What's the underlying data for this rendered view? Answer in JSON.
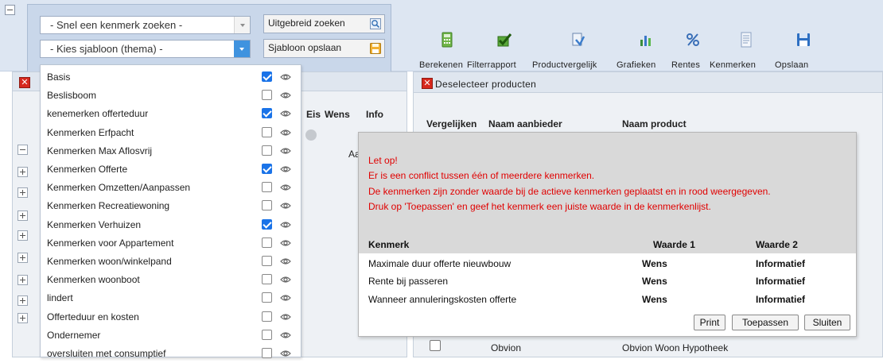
{
  "header": {
    "quick_search": {
      "value": "- Snel een kenmerk zoeken -"
    },
    "template_select": {
      "value": "- Kies sjabloon (thema) -"
    },
    "advanced_search_label": "Uitgebreid zoeken",
    "save_template_label": "Sjabloon opslaan",
    "toolbar": [
      {
        "label": "Berekenen",
        "icon": "calculator-icon"
      },
      {
        "label": "Filterrapport",
        "icon": "checkmark-icon"
      },
      {
        "label": "Productvergelijk",
        "icon": "compare-icon"
      },
      {
        "label": "Grafieken",
        "icon": "bar-chart-icon"
      },
      {
        "label": "Rentes",
        "icon": "percent-icon"
      },
      {
        "label": "Kenmerken",
        "icon": "document-icon"
      },
      {
        "label": "Opslaan",
        "icon": "floppy-icon"
      }
    ]
  },
  "left_panel": {
    "columns": [
      "Eis",
      "Wens",
      "Info"
    ],
    "row_label": "Aa"
  },
  "template_dropdown": {
    "items": [
      {
        "label": "Basis",
        "checked": true
      },
      {
        "label": "Beslisboom",
        "checked": false
      },
      {
        "label": "kenemerken offerteduur",
        "checked": true
      },
      {
        "label": "Kenmerken Erfpacht",
        "checked": false
      },
      {
        "label": "Kenmerken Max Aflosvrij",
        "checked": false
      },
      {
        "label": "Kenmerken Offerte",
        "checked": true
      },
      {
        "label": "Kenmerken Omzetten/Aanpassen",
        "checked": false
      },
      {
        "label": "Kenmerken Recreatiewoning",
        "checked": false
      },
      {
        "label": "Kenmerken Verhuizen",
        "checked": true
      },
      {
        "label": "Kenmerken voor Appartement",
        "checked": false
      },
      {
        "label": "Kenmerken woon/winkelpand",
        "checked": false
      },
      {
        "label": "Kenmerken woonboot",
        "checked": false
      },
      {
        "label": "lindert",
        "checked": false
      },
      {
        "label": "Offerteduur en kosten",
        "checked": false
      },
      {
        "label": "Ondernemer",
        "checked": false
      },
      {
        "label": "oversluiten met consumptief",
        "checked": false
      }
    ]
  },
  "right_panel": {
    "deselect_label": "Deselecteer producten",
    "columns": [
      "Vergelijken",
      "Naam aanbieder",
      "Naam product"
    ],
    "visible_row": {
      "aanbieder": "Obvion",
      "product": "Obvion Woon Hypotheek"
    }
  },
  "conflict_dialog": {
    "lines": [
      "Let op!",
      "Er is een conflict tussen één of meerdere kenmerken.",
      "De kenmerken zijn zonder waarde bij de actieve kenmerken geplaatst en in rood weergegeven.",
      "Druk op 'Toepassen' en geef het kenmerk een juiste waarde in de kenmerkenlijst."
    ],
    "table": {
      "headers": [
        "Kenmerk",
        "Waarde 1",
        "Waarde 2"
      ],
      "rows": [
        [
          "Maximale duur offerte nieuwbouw",
          "Wens",
          "Informatief"
        ],
        [
          "Rente bij passeren",
          "Wens",
          "Informatief"
        ],
        [
          "Wanneer annuleringskosten offerte",
          "Wens",
          "Informatief"
        ]
      ]
    },
    "buttons": {
      "print": "Print",
      "apply": "Toepassen",
      "close": "Sluiten"
    }
  },
  "colors": {
    "header_bg": "#dde6f2",
    "accent_blue": "#3f93df",
    "check_blue": "#1a73e8",
    "warning_red": "#e00000",
    "dialog_bg": "#d9d9d9"
  }
}
